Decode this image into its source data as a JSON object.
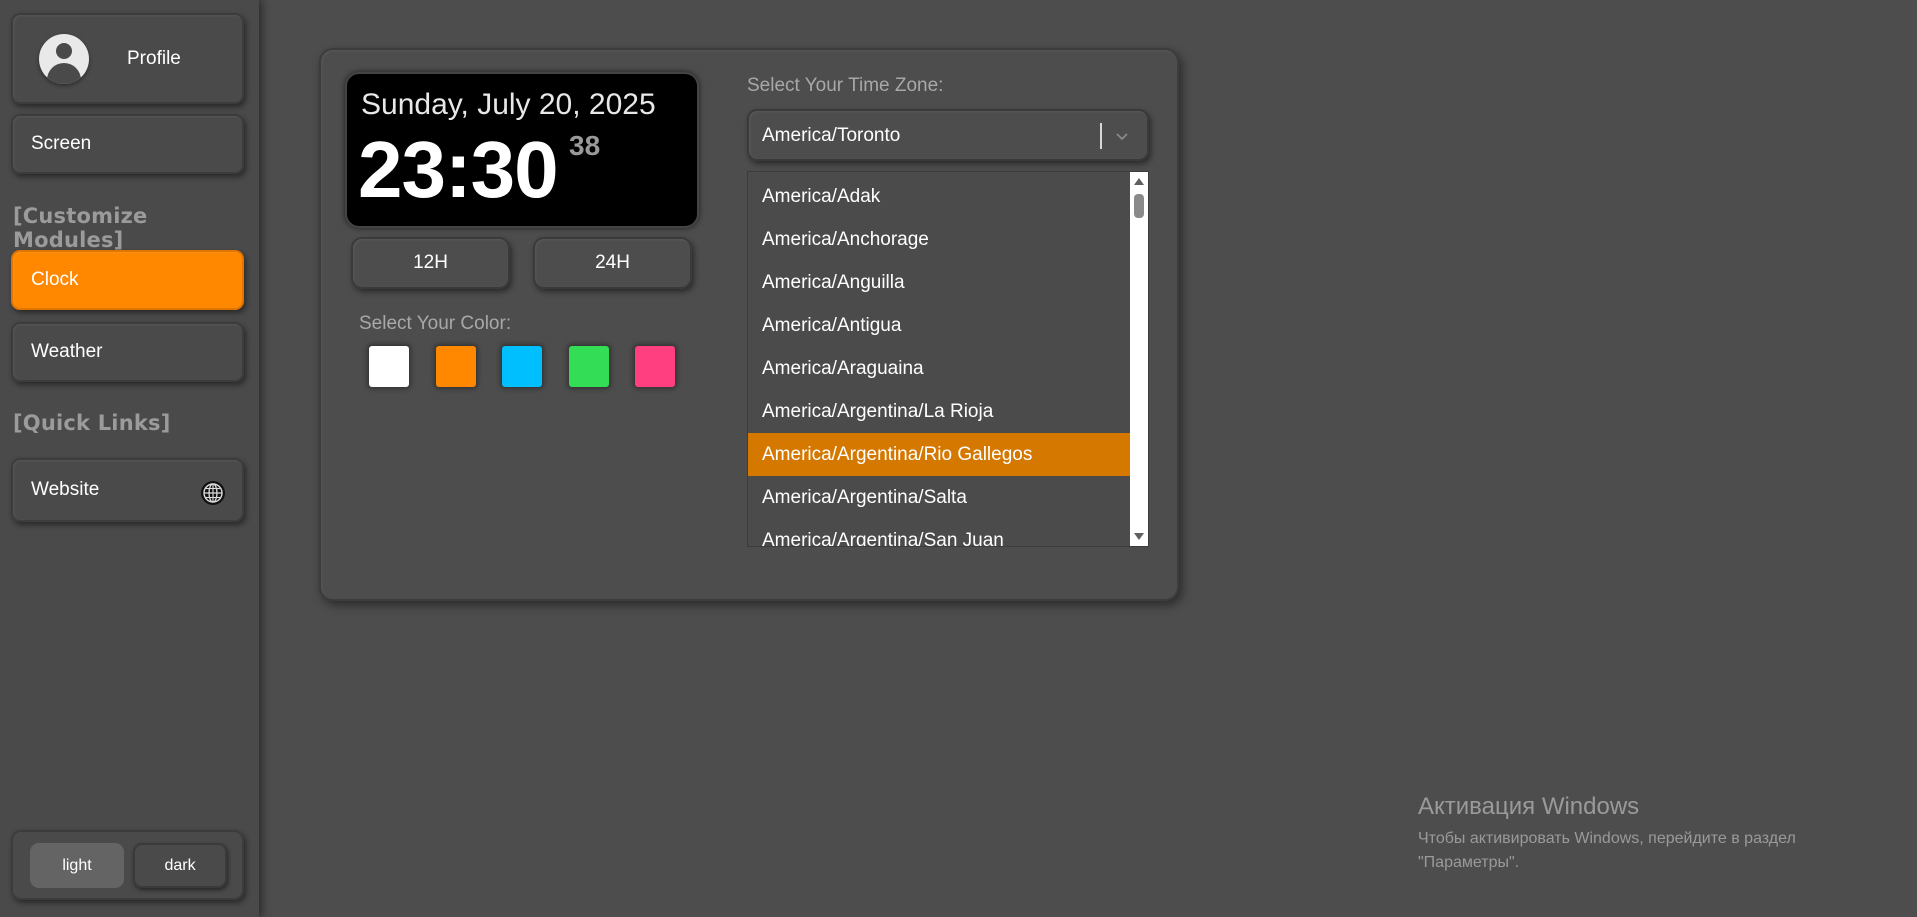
{
  "sidebar": {
    "profile_label": "Profile",
    "screen_label": "Screen",
    "customize_heading": "[Customize Modules]",
    "clock_label": "Clock",
    "weather_label": "Weather",
    "quick_links_heading": "[Quick Links]",
    "website_label": "Website",
    "theme": {
      "light_label": "light",
      "dark_label": "dark",
      "selected": "light"
    }
  },
  "clock": {
    "date": "Sunday, July 20, 2025",
    "time": "23:30",
    "seconds": "38",
    "format_12_label": "12H",
    "format_24_label": "24H",
    "color_label": "Select Your Color:",
    "colors": [
      "#ffffff",
      "#ff8800",
      "#00bfff",
      "#33dd55",
      "#ff3f7f"
    ]
  },
  "timezone": {
    "label": "Select Your Time Zone:",
    "value": "America/Toronto",
    "options": [
      "America/Adak",
      "America/Anchorage",
      "America/Anguilla",
      "America/Antigua",
      "America/Araguaina",
      "America/Argentina/La Rioja",
      "America/Argentina/Rio Gallegos",
      "America/Argentina/Salta",
      "America/Argentina/San Juan"
    ],
    "highlighted": "America/Argentina/Rio Gallegos"
  },
  "activation": {
    "title": "Активация Windows",
    "line1": "Чтобы активировать Windows, перейдите в раздел",
    "line2": "\"Параметры\"."
  },
  "accent_color": "#ff8800"
}
